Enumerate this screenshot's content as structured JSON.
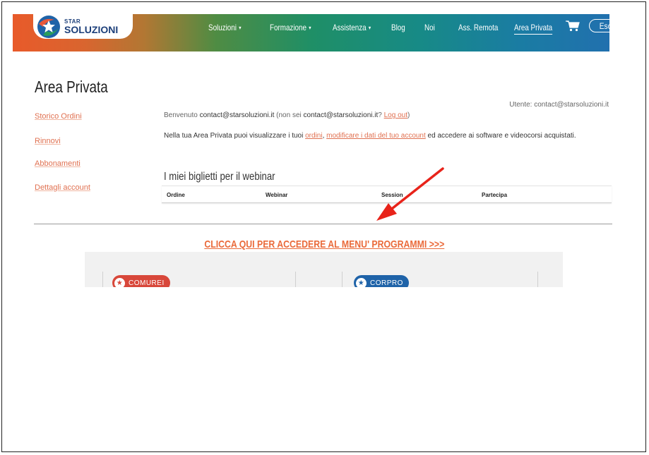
{
  "brand": {
    "top": "STAR",
    "name": "SOLUZIONI"
  },
  "nav": {
    "items": [
      {
        "label": "Soluzioni",
        "dropdown": true
      },
      {
        "label": "Formazione",
        "dropdown": true
      },
      {
        "label": "Assistenza",
        "dropdown": true
      },
      {
        "label": "Blog",
        "dropdown": false
      },
      {
        "label": "Noi",
        "dropdown": false
      },
      {
        "label": "Ass. Remota",
        "dropdown": false
      },
      {
        "label": "Area Privata",
        "dropdown": false,
        "active": true
      }
    ],
    "caret": "▾",
    "logout_label": "Esci"
  },
  "page": {
    "title": "Area Privata"
  },
  "sidebar": {
    "items": [
      "Storico Ordini",
      "Rinnovi",
      "Abbonamenti",
      "Dettagli account"
    ]
  },
  "account": {
    "user_label": "Utente: contact@starsoluzioni.it",
    "welcome_prefix": "Benvenuto ",
    "welcome_email": "contact@starsoluzioni.it",
    "welcome_mid": " (non sei ",
    "welcome_email2": "contact@starsoluzioni.it",
    "welcome_q": "? ",
    "logout_link": "Log out",
    "welcome_end": ")",
    "intro_prefix": "Nella tua Area Privata puoi visualizzare i tuoi ",
    "intro_link1": "ordini",
    "intro_sep": ", ",
    "intro_link2": "modificare i dati del tuo account",
    "intro_suffix": " ed accedere ai software e videocorsi acquistati."
  },
  "webinar": {
    "title": "I miei biglietti per il webinar",
    "columns": [
      "Ordine",
      "Webinar",
      "Session",
      "Partecipa"
    ]
  },
  "cta": {
    "label": "CLICCA QUI PER ACCEDERE AL MENU' PROGRAMMI >>>"
  },
  "programs": [
    {
      "label": "COMUREI",
      "color": "#d8473a"
    },
    {
      "label": "CORPRO",
      "color": "#1f63a8"
    }
  ],
  "annotation": {
    "arrow_color": "#e8231a"
  }
}
